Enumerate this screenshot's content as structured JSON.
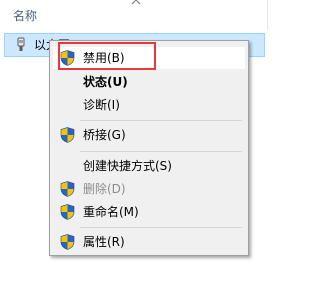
{
  "explorer": {
    "column_name": "名称",
    "selected_item_label": "以太网",
    "selected_item_icon": "network-adapter-icon",
    "sort_icon": "chevron-up-icon"
  },
  "context_menu": {
    "items": [
      {
        "label": "禁用(B)",
        "icon": "uac-shield-icon",
        "state": "hover"
      },
      {
        "label": "状态(U)",
        "icon": null,
        "state": "default-bold"
      },
      {
        "label": "诊断(I)",
        "icon": null,
        "state": "normal"
      },
      {
        "label": "桥接(G)",
        "icon": "uac-shield-icon",
        "state": "normal"
      },
      {
        "label": "创建快捷方式(S)",
        "icon": null,
        "state": "normal"
      },
      {
        "label": "删除(D)",
        "icon": "uac-shield-icon",
        "state": "disabled"
      },
      {
        "label": "重命名(M)",
        "icon": "uac-shield-icon",
        "state": "normal"
      },
      {
        "label": "属性(R)",
        "icon": "uac-shield-icon",
        "state": "normal"
      }
    ]
  },
  "colors": {
    "selection_bg": "#cce8ff",
    "selection_border": "#99d1ff",
    "menu_bg": "#f0f0f0",
    "highlight_annotation": "#e8383d",
    "shield_blue": "#2a63c4",
    "shield_yellow": "#f5c400"
  }
}
